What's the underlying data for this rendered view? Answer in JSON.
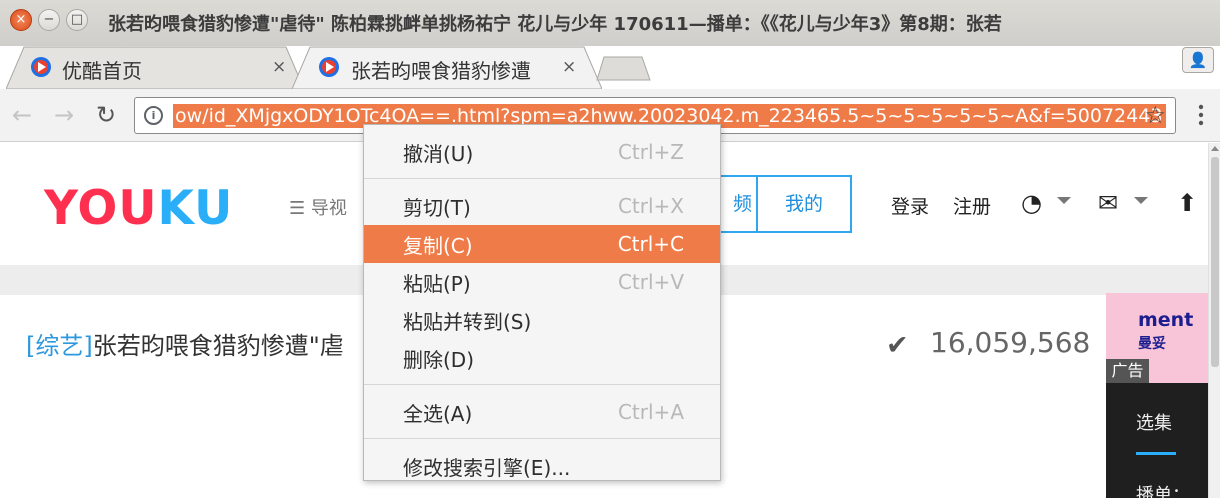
{
  "window": {
    "title": "张若昀喂食猎豹惨遭\"虐待\" 陈柏霖挑衅单挑杨祐宁 花儿与少年 170611—播单：《《花儿与少年3》第8期：张若",
    "close_icon": "×",
    "min_icon": "−",
    "max_icon": "□"
  },
  "tabs": [
    {
      "title": "优酷首页",
      "close": "×"
    },
    {
      "title": "张若昀喂食猎豹惨遭",
      "close": "×"
    }
  ],
  "profile_icon": "👤",
  "toolbar": {
    "back_icon": "←",
    "forward_icon": "→",
    "reload_icon": "↻",
    "info_icon": "i",
    "url": "ow/id_XMjgxODY1OTc4OA==.html?spm=a2hww.20023042.m_223465.5~5~5~5~5~5~A&f=50072443",
    "star_icon": "☆",
    "menu_icon": "⋮"
  },
  "page": {
    "logo_you": "YOU",
    "logo_ku": "KU",
    "nav_guide": "☰ 导视",
    "tab_partial": "频",
    "tab_mine": "我的",
    "login": "登录",
    "register": "注册",
    "history_icon": "◔",
    "mail_icon": "✉",
    "upload_icon": "⬆",
    "video_tag": "[综艺]",
    "video_title": "张若昀喂食猎豹惨遭\"虐",
    "views_icon": "✔",
    "views_count": "16,059,568",
    "ad_text": "ment",
    "ad_sub": "曼妥",
    "ad_label": "广告",
    "side_select": "选集",
    "side_playlist": "播单："
  },
  "context_menu": {
    "groups": [
      [
        {
          "label": "撤消(U)",
          "accel": "Ctrl+Z"
        }
      ],
      [
        {
          "label": "剪切(T)",
          "accel": "Ctrl+X"
        },
        {
          "label": "复制(C)",
          "accel": "Ctrl+C",
          "highlighted": true
        },
        {
          "label": "粘贴(P)",
          "accel": "Ctrl+V"
        },
        {
          "label": "粘贴并转到(S)",
          "accel": ""
        },
        {
          "label": "删除(D)",
          "accel": ""
        }
      ],
      [
        {
          "label": "全选(A)",
          "accel": "Ctrl+A"
        }
      ],
      [
        {
          "label": "修改搜索引擎(E)...",
          "accel": ""
        }
      ]
    ]
  },
  "colors": {
    "highlight": "#ef7c48",
    "youku_red": "#ff2f4f",
    "youku_blue": "#2aaef7"
  }
}
